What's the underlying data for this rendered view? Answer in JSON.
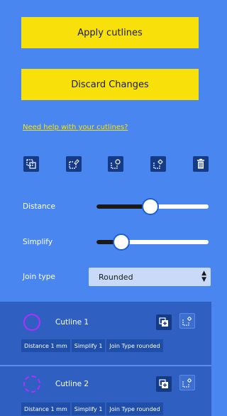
{
  "actions": {
    "apply_label": "Apply cutlines",
    "discard_label": "Discard Changes",
    "help_link": "Need help with your cutlines?"
  },
  "tools": [
    "add-cutline-icon",
    "edit-node-icon",
    "reshape-icon",
    "settings-icon",
    "trash-icon"
  ],
  "controls": {
    "distance": {
      "label": "Distance",
      "level": 0.48
    },
    "simplify": {
      "label": "Simplify",
      "level": 0.22
    },
    "join_type": {
      "label": "Join type",
      "value": "Rounded"
    }
  },
  "cutlines": [
    {
      "name": "Cutline 1",
      "distance": "Distance 1 mm",
      "simplify": "Simplify 1",
      "join_type": "Join Type rounded"
    },
    {
      "name": "Cutline 2",
      "distance": "Distance 1 mm",
      "simplify": "Simplify 1",
      "join_type": "Join Type rounded"
    }
  ],
  "colors": {
    "background": "#4a86f0",
    "accent_yellow": "#f8e10a",
    "cutline_purple": "#b32dff",
    "panel_dark": "#2f5fc0"
  }
}
